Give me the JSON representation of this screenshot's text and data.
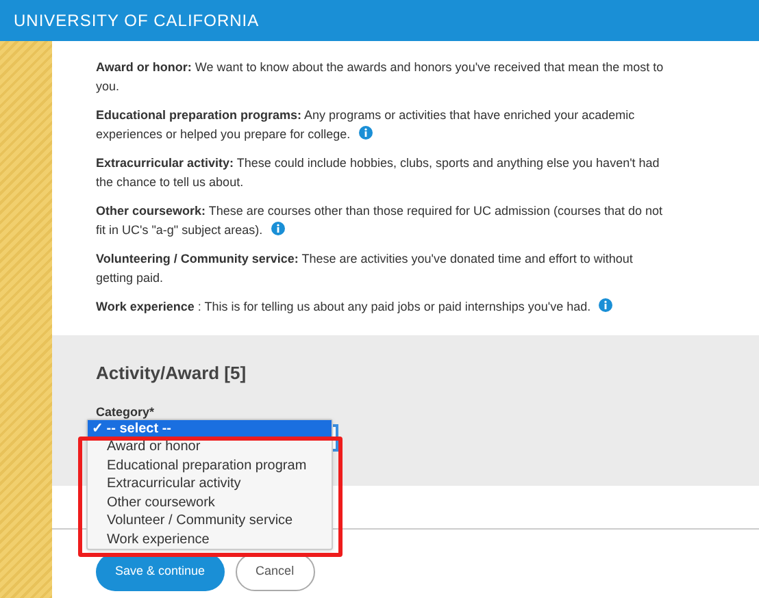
{
  "header": {
    "title": "UNIVERSITY OF CALIFORNIA"
  },
  "descriptions": [
    {
      "term": "Award or honor:",
      "text": "We want to know about the awards and honors you've received that mean the most to you.",
      "info": false
    },
    {
      "term": "Educational preparation programs:",
      "text": "Any programs or activities that have enriched your academic experiences or helped you prepare for college.",
      "info": true
    },
    {
      "term": "Extracurricular activity:",
      "text": "These could include hobbies, clubs, sports and anything else you haven't had the chance to tell us about.",
      "info": false
    },
    {
      "term": "Other coursework:",
      "text": "These are courses other than those required for UC admission (courses that do not fit in UC's \"a-g\" subject areas).",
      "info": true
    },
    {
      "term": "Volunteering / Community service:",
      "text": "These are activities you've donated time and effort to without getting paid.",
      "info": false
    },
    {
      "term": "Work experience",
      "text": ": This is for telling us about any paid jobs or paid internships you've had.",
      "info": true
    }
  ],
  "section": {
    "heading": "Activity/Award [5]",
    "field_label": "Category*",
    "dropdown": {
      "expanded": true,
      "check_mark": "✓",
      "options": [
        {
          "label": "-- select --",
          "selected": true
        },
        {
          "label": "Award or honor",
          "selected": false
        },
        {
          "label": "Educational preparation program",
          "selected": false
        },
        {
          "label": "Extracurricular activity",
          "selected": false
        },
        {
          "label": "Other coursework",
          "selected": false
        },
        {
          "label": "Volunteer / Community service",
          "selected": false
        },
        {
          "label": "Work experience",
          "selected": false
        }
      ]
    },
    "highlight": true
  },
  "buttons": [
    {
      "label": "Save & continue",
      "kind": "primary"
    },
    {
      "label": "Cancel",
      "kind": "secondary"
    }
  ]
}
